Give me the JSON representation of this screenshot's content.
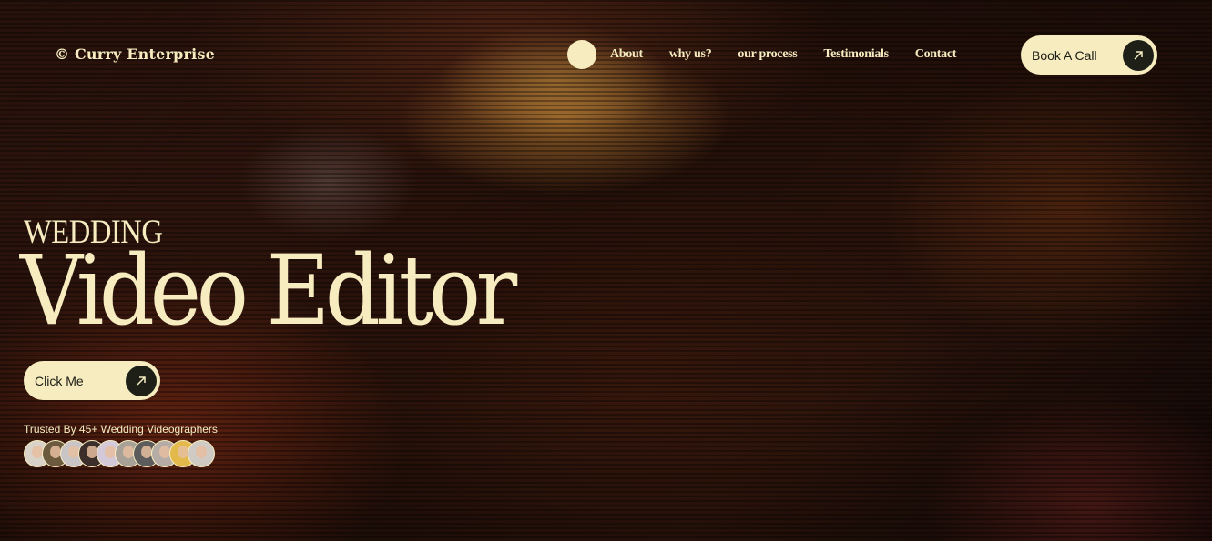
{
  "brand": "© Curry Enterprise",
  "nav": {
    "links": [
      "About",
      "why us?",
      "our process",
      "Testimonials",
      "Contact"
    ],
    "cta": "Book A Call"
  },
  "hero": {
    "pretitle": "WEDDING",
    "title": "Video Editor",
    "cta": "Click Me",
    "trusted": "Trusted By 45+ Wedding Videographers"
  },
  "avatars": [
    {
      "bg": "#d9d2c9"
    },
    {
      "bg": "#6b5a3d"
    },
    {
      "bg": "#c9c5c7"
    },
    {
      "bg": "#3b2e2b"
    },
    {
      "bg": "#d4c9d9"
    },
    {
      "bg": "#a8a197"
    },
    {
      "bg": "#5c5c5c"
    },
    {
      "bg": "#b5aca6"
    },
    {
      "bg": "#e2b94a"
    },
    {
      "bg": "#cfcac3"
    }
  ],
  "colors": {
    "cream": "#f6ecc0",
    "dark": "#1e2017"
  },
  "icons": {
    "cta_arrow": "arrow-up-right-icon"
  }
}
